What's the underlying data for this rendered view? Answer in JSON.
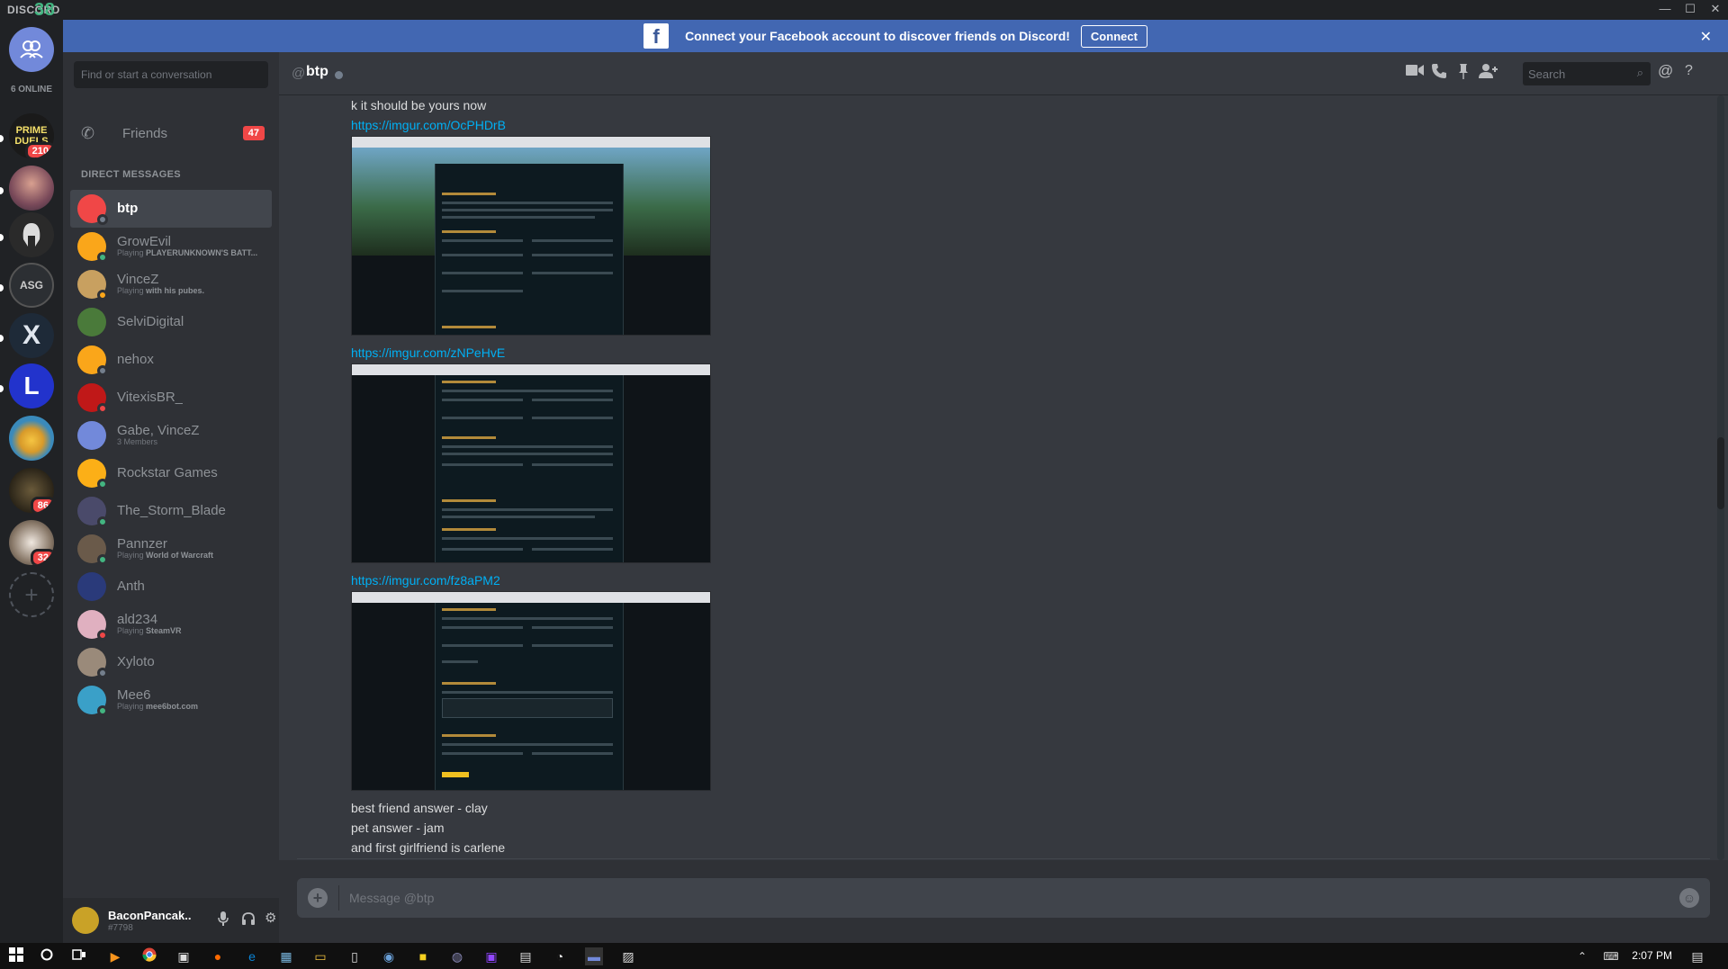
{
  "window": {
    "brand": "DISCORD",
    "brand_number": "38",
    "minimize": "—",
    "maximize": "☐",
    "close": "✕"
  },
  "guilds": {
    "online_label": "6 ONLINE",
    "items": [
      {
        "name": "home-server",
        "label": "",
        "badge": "",
        "color": "#7289da"
      },
      {
        "name": "prime-duels",
        "label": "PRIME DUELS",
        "badge": "210",
        "color": "#1a1a1a"
      },
      {
        "name": "server-avatar-1",
        "label": "",
        "badge": "",
        "color": "#8a5a6a"
      },
      {
        "name": "spartan",
        "label": "",
        "badge": "",
        "color": "#2a2a2a"
      },
      {
        "name": "asg",
        "label": "ASG",
        "badge": "",
        "color": "#333"
      },
      {
        "name": "x-server",
        "label": "X",
        "badge": "",
        "color": "#1e2a38"
      },
      {
        "name": "l-server",
        "label": "L",
        "badge": "",
        "color": "#2233aa"
      },
      {
        "name": "cat-server",
        "label": "",
        "badge": "",
        "color": "#3a8abb"
      },
      {
        "name": "dark-server",
        "label": "",
        "badge": "86",
        "color": "#3a3020"
      },
      {
        "name": "raccoon-server",
        "label": "",
        "badge": "32",
        "color": "#c8b8a8"
      }
    ],
    "add_label": "+"
  },
  "facebook_bar": {
    "logo": "f",
    "message": "Connect your Facebook account to discover friends on Discord!",
    "connect_label": "Connect",
    "close": "✕"
  },
  "sidebar": {
    "search_placeholder": "Find or start a conversation",
    "friends_label": "Friends",
    "friends_count": "47",
    "dm_header": "DIRECT MESSAGES",
    "dms": [
      {
        "name": "btp",
        "activity": "",
        "activity_game": "",
        "color": "#f04747",
        "status": "#747f8d",
        "active": true
      },
      {
        "name": "GrowEvil",
        "activity": "Playing ",
        "activity_game": "PLAYERUNKNOWN'S BATT...",
        "color": "#faa61a",
        "status": "#43b581",
        "active": false
      },
      {
        "name": "VinceZ",
        "activity": "Playing ",
        "activity_game": "with his pubes.",
        "color": "#c8a060",
        "status": "#faa61a",
        "active": false
      },
      {
        "name": "SelviDigital",
        "activity": "",
        "activity_game": "",
        "color": "#4a7a3a",
        "status": "",
        "active": false
      },
      {
        "name": "nehox",
        "activity": "",
        "activity_game": "",
        "color": "#faa61a",
        "status": "#747f8d",
        "active": false
      },
      {
        "name": "VitexisBR_",
        "activity": "",
        "activity_game": "",
        "color": "#c01818",
        "status": "#f04747",
        "active": false
      },
      {
        "name": "Gabe, VinceZ",
        "activity": "3 Members",
        "activity_game": "",
        "color": "#7289da",
        "status": "",
        "active": false
      },
      {
        "name": "Rockstar Games",
        "activity": "",
        "activity_game": "",
        "color": "#fcaf17",
        "status": "#43b581",
        "active": false
      },
      {
        "name": "The_Storm_Blade",
        "activity": "",
        "activity_game": "",
        "color": "#4a4a6a",
        "status": "#43b581",
        "active": false
      },
      {
        "name": "Pannzer",
        "activity": "Playing ",
        "activity_game": "World of Warcraft",
        "color": "#6a5a4a",
        "status": "#43b581",
        "active": false
      },
      {
        "name": "Anth",
        "activity": "",
        "activity_game": "",
        "color": "#2a3a7a",
        "status": "",
        "active": false
      },
      {
        "name": "ald234",
        "activity": "Playing ",
        "activity_game": "SteamVR",
        "color": "#e0b0c0",
        "status": "#f04747",
        "active": false
      },
      {
        "name": "Xyloto",
        "activity": "",
        "activity_game": "",
        "color": "#9a8a7a",
        "status": "#747f8d",
        "active": false
      },
      {
        "name": "Mee6",
        "activity": "Playing ",
        "activity_game": "mee6bot.com",
        "color": "#3aa0c8",
        "status": "#43b581",
        "active": false
      }
    ]
  },
  "user_panel": {
    "username": "BaconPancak..",
    "tag": "#7798",
    "mic": "🎤",
    "headphones": "🎧",
    "settings": "⚙"
  },
  "header": {
    "at": "@",
    "name": "btp",
    "search_placeholder": "Search",
    "icons": [
      "video-call-icon",
      "voice-call-icon",
      "pin-icon",
      "add-friend-icon",
      "mention-icon",
      "help-icon"
    ]
  },
  "messages": {
    "line1": "k it should be yours now",
    "link1": "https://imgur.com/OcPHDrB",
    "link2": "https://imgur.com/zNPeHvE",
    "link3": "https://imgur.com/fz8aPM2",
    "line2": "best friend answer - clay",
    "line3": "pet answer - jam",
    "line4": "and first girlfriend is carlene"
  },
  "composer": {
    "placeholder": "Message @btp",
    "add": "+",
    "emoji": "☺"
  },
  "taskbar": {
    "clock": "2:07 PM"
  }
}
